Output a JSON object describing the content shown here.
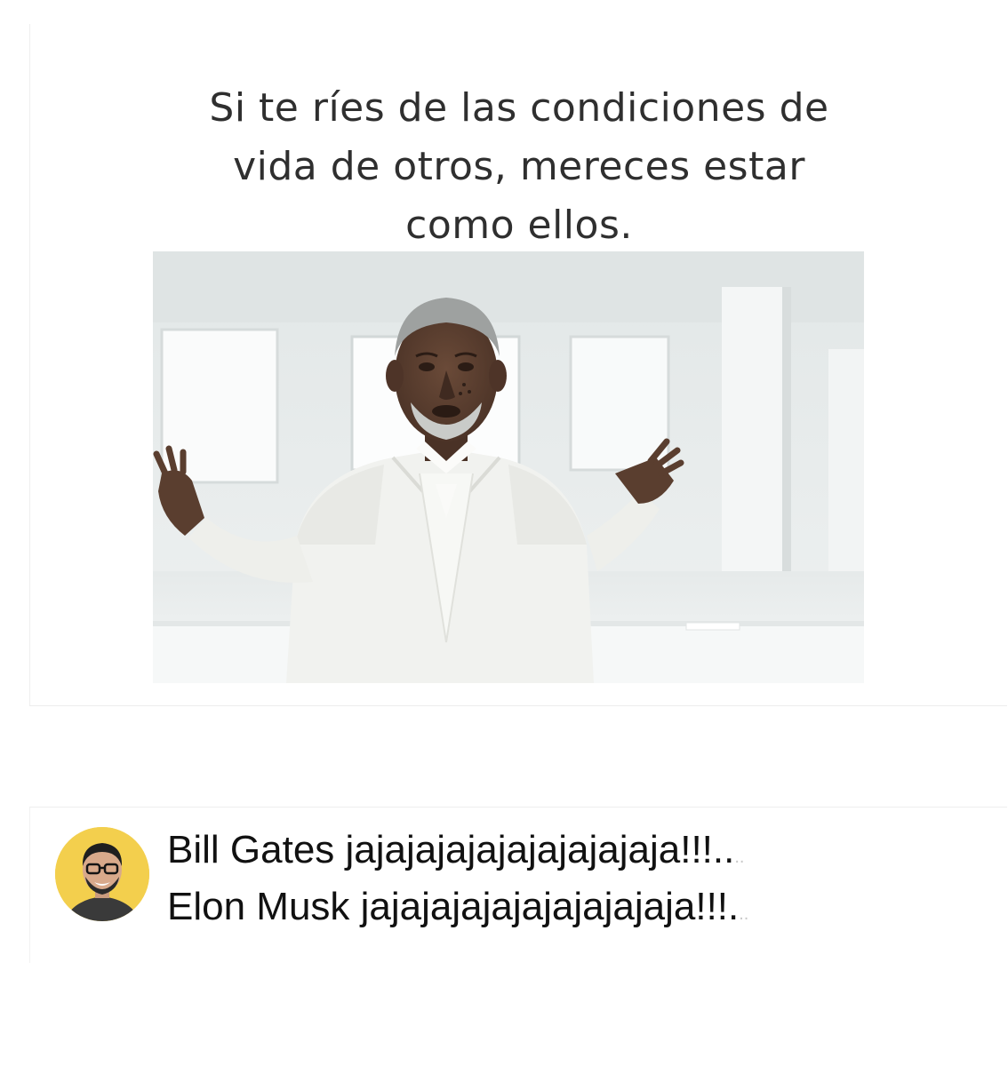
{
  "meme": {
    "caption_lines": [
      "Si te ríes de las condiciones de",
      "vida de otros, mereces estar",
      "como ellos."
    ]
  },
  "comment": {
    "lines": [
      "Bill Gates jajajajajajajajajajaja!!!..",
      "Elon Musk jajajajajajajajajajaja!!!."
    ],
    "trailing": [
      "..",
      ".."
    ]
  },
  "colors": {
    "caption_text": "#2f2f2f",
    "comment_text": "#111111",
    "avatar_bg": "#f3cf4d",
    "scene_bg": "#e9ecec"
  }
}
